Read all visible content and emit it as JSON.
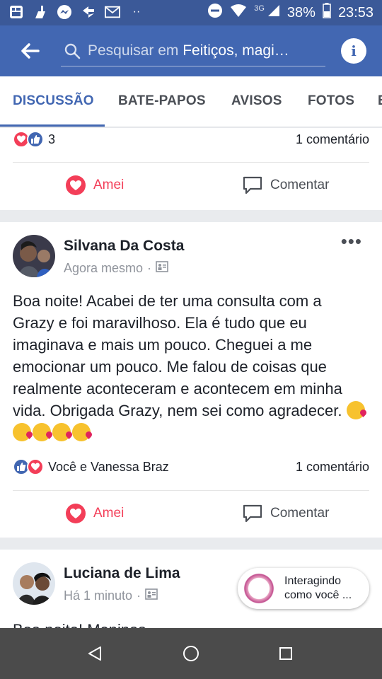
{
  "status_bar": {
    "network": "3G",
    "battery": "38%",
    "time": "23:53"
  },
  "header": {
    "search_prefix": "Pesquisar em ",
    "search_group": "Feitiços, magi…",
    "info_label": "i"
  },
  "tabs": [
    {
      "label": "DISCUSSÃO",
      "active": true
    },
    {
      "label": "BATE-PAPOS"
    },
    {
      "label": "AVISOS"
    },
    {
      "label": "FOTOS"
    },
    {
      "label": "E"
    }
  ],
  "prev_post": {
    "reaction_count": "3",
    "comment_count": "1 comentário",
    "love_label": "Amei",
    "comment_label": "Comentar"
  },
  "post1": {
    "author": "Silvana Da Costa",
    "time": "Agora mesmo",
    "text": "Boa noite! Acabei de ter uma consulta com a Grazy e foi maravilhoso. Ela é  tudo que eu imaginava e mais um pouco. Cheguei a me emocionar um pouco. Me falou de coisas que realmente aconteceram e acontecem em minha vida. Obrigada Grazy, nem sei como agradecer.",
    "reactors": "Você e Vanessa Braz",
    "comment_count": "1 comentário",
    "love_label": "Amei",
    "comment_label": "Comentar"
  },
  "post2": {
    "author": "Luciana de Lima",
    "time": "Há 1 minuto",
    "text_partial": "Boa noite! Meninas"
  },
  "chat_chip": {
    "line1": "Interagindo",
    "line2": "como você ..."
  },
  "colors": {
    "facebook_blue": "#4267b2",
    "status_blue": "#3b5998",
    "love_red": "#f33e58"
  }
}
